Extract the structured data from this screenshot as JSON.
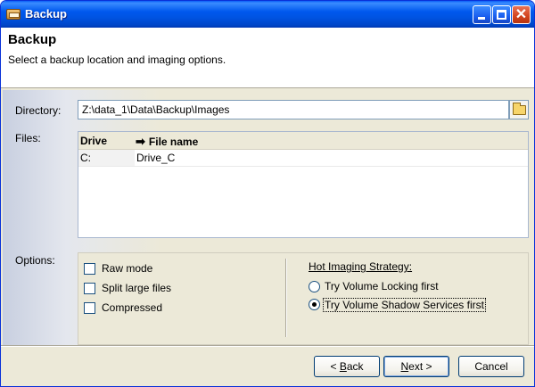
{
  "window": {
    "title": "Backup"
  },
  "header": {
    "title": "Backup",
    "subtitle": "Select a backup location and imaging options."
  },
  "labels": {
    "directory": "Directory:",
    "files": "Files:",
    "options": "Options:"
  },
  "directory": {
    "value": "Z:\\data_1\\Data\\Backup\\Images"
  },
  "files": {
    "columns": [
      "Drive",
      "File name"
    ],
    "rows": [
      {
        "drive": "C:",
        "file_name": "Drive_C"
      }
    ]
  },
  "options": {
    "checkboxes": [
      {
        "label": "Raw mode",
        "checked": false
      },
      {
        "label": "Split large files",
        "checked": false
      },
      {
        "label": "Compressed",
        "checked": false
      }
    ],
    "hot_imaging": {
      "title": "Hot Imaging Strategy:",
      "choices": [
        {
          "label": "Try Volume Locking first",
          "selected": false
        },
        {
          "label": "Try Volume Shadow Services first",
          "selected": true
        }
      ]
    }
  },
  "buttons": {
    "back_prefix": "< ",
    "back_key": "B",
    "back_rest": "ack",
    "next_key": "N",
    "next_rest": "ext >",
    "cancel": "Cancel"
  },
  "icons": {
    "browse": "folder-icon",
    "sort": "arrow-right-icon"
  }
}
